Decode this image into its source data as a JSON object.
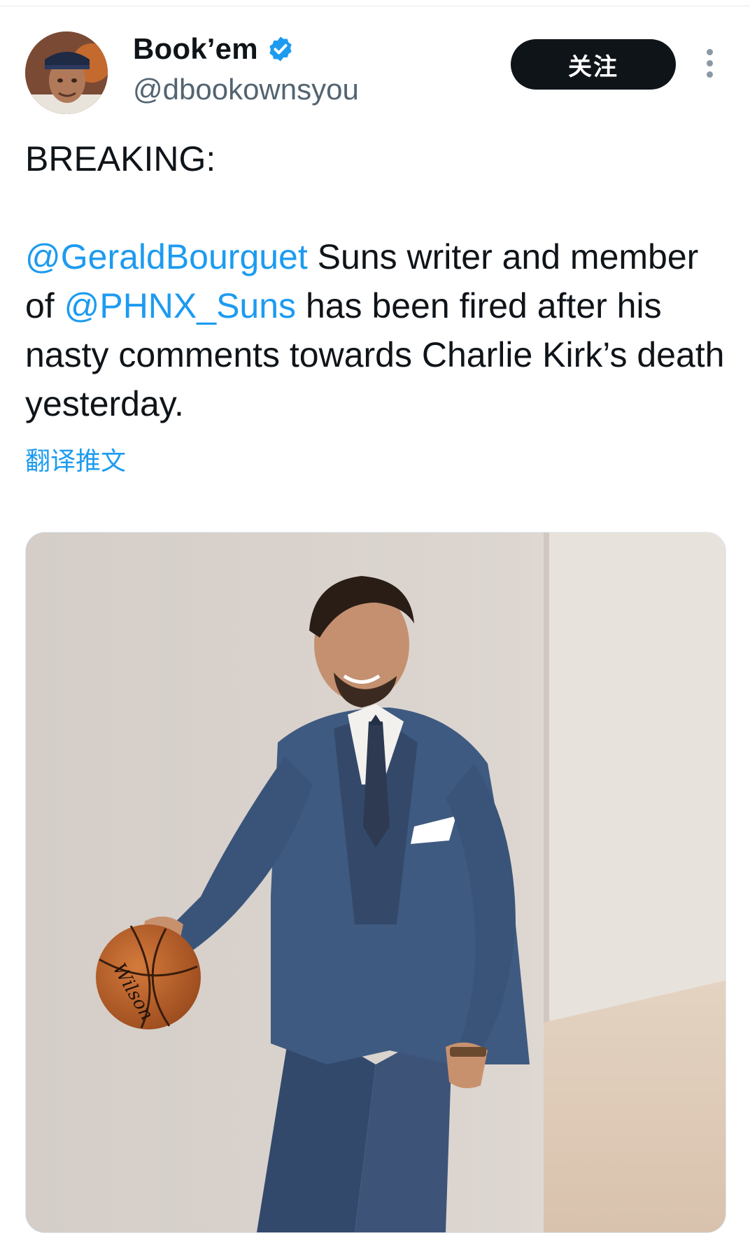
{
  "tweet": {
    "author": {
      "display_name": "Book’em",
      "handle": "@dbookownsyou",
      "verified": true,
      "avatar_icon": "avatar-photo"
    },
    "follow_label": "关注",
    "more_icon": "more-vertical-icon",
    "text": {
      "line1": "BREAKING:",
      "mention1": "@GeraldBourguet",
      "seg1": " Suns writer and member of ",
      "mention2": "@PHNX_Suns",
      "seg2": " has been fired after his nasty comments towards Charlie Kirk’s death yesterday."
    },
    "translate_label": "翻译推文",
    "media": {
      "ball_text": "Wilson"
    }
  },
  "colors": {
    "link": "#1d9bf0",
    "text": "#0f1419",
    "secondary": "#536471",
    "button_bg": "#0f1419"
  }
}
